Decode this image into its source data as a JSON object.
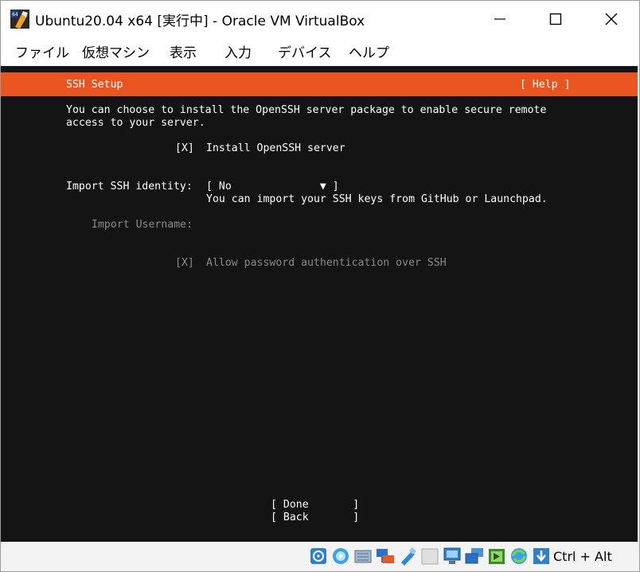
{
  "window": {
    "title": "Ubuntu20.04 x64 [実行中] - Oracle VM VirtualBox"
  },
  "menu": [
    "ファイル",
    "仮想マシン",
    "表示",
    "入力",
    "デバイス",
    "ヘルプ"
  ],
  "installer": {
    "header_title": "SSH Setup",
    "help_label": "[ Help ]",
    "intro_line1": "You can choose to install the OpenSSH server package to enable secure remote",
    "intro_line2": "access to your server.",
    "install_checkbox": "[X]",
    "install_label": "Install OpenSSH server",
    "import_label": "Import SSH identity:",
    "import_select": "[ No              ▼ ]",
    "import_hint": "You can import your SSH keys from GitHub or Launchpad.",
    "username_label": "Import Username:",
    "password_checkbox": "[X]",
    "password_label": "Allow password authentication over SSH",
    "done_button": "[ Done       ]",
    "back_button": "[ Back       ]"
  },
  "statusbar": {
    "hostkey": "Ctrl + Alt"
  },
  "colors": {
    "ubuntu_orange": "#e95420",
    "terminal_bg": "#141414"
  }
}
